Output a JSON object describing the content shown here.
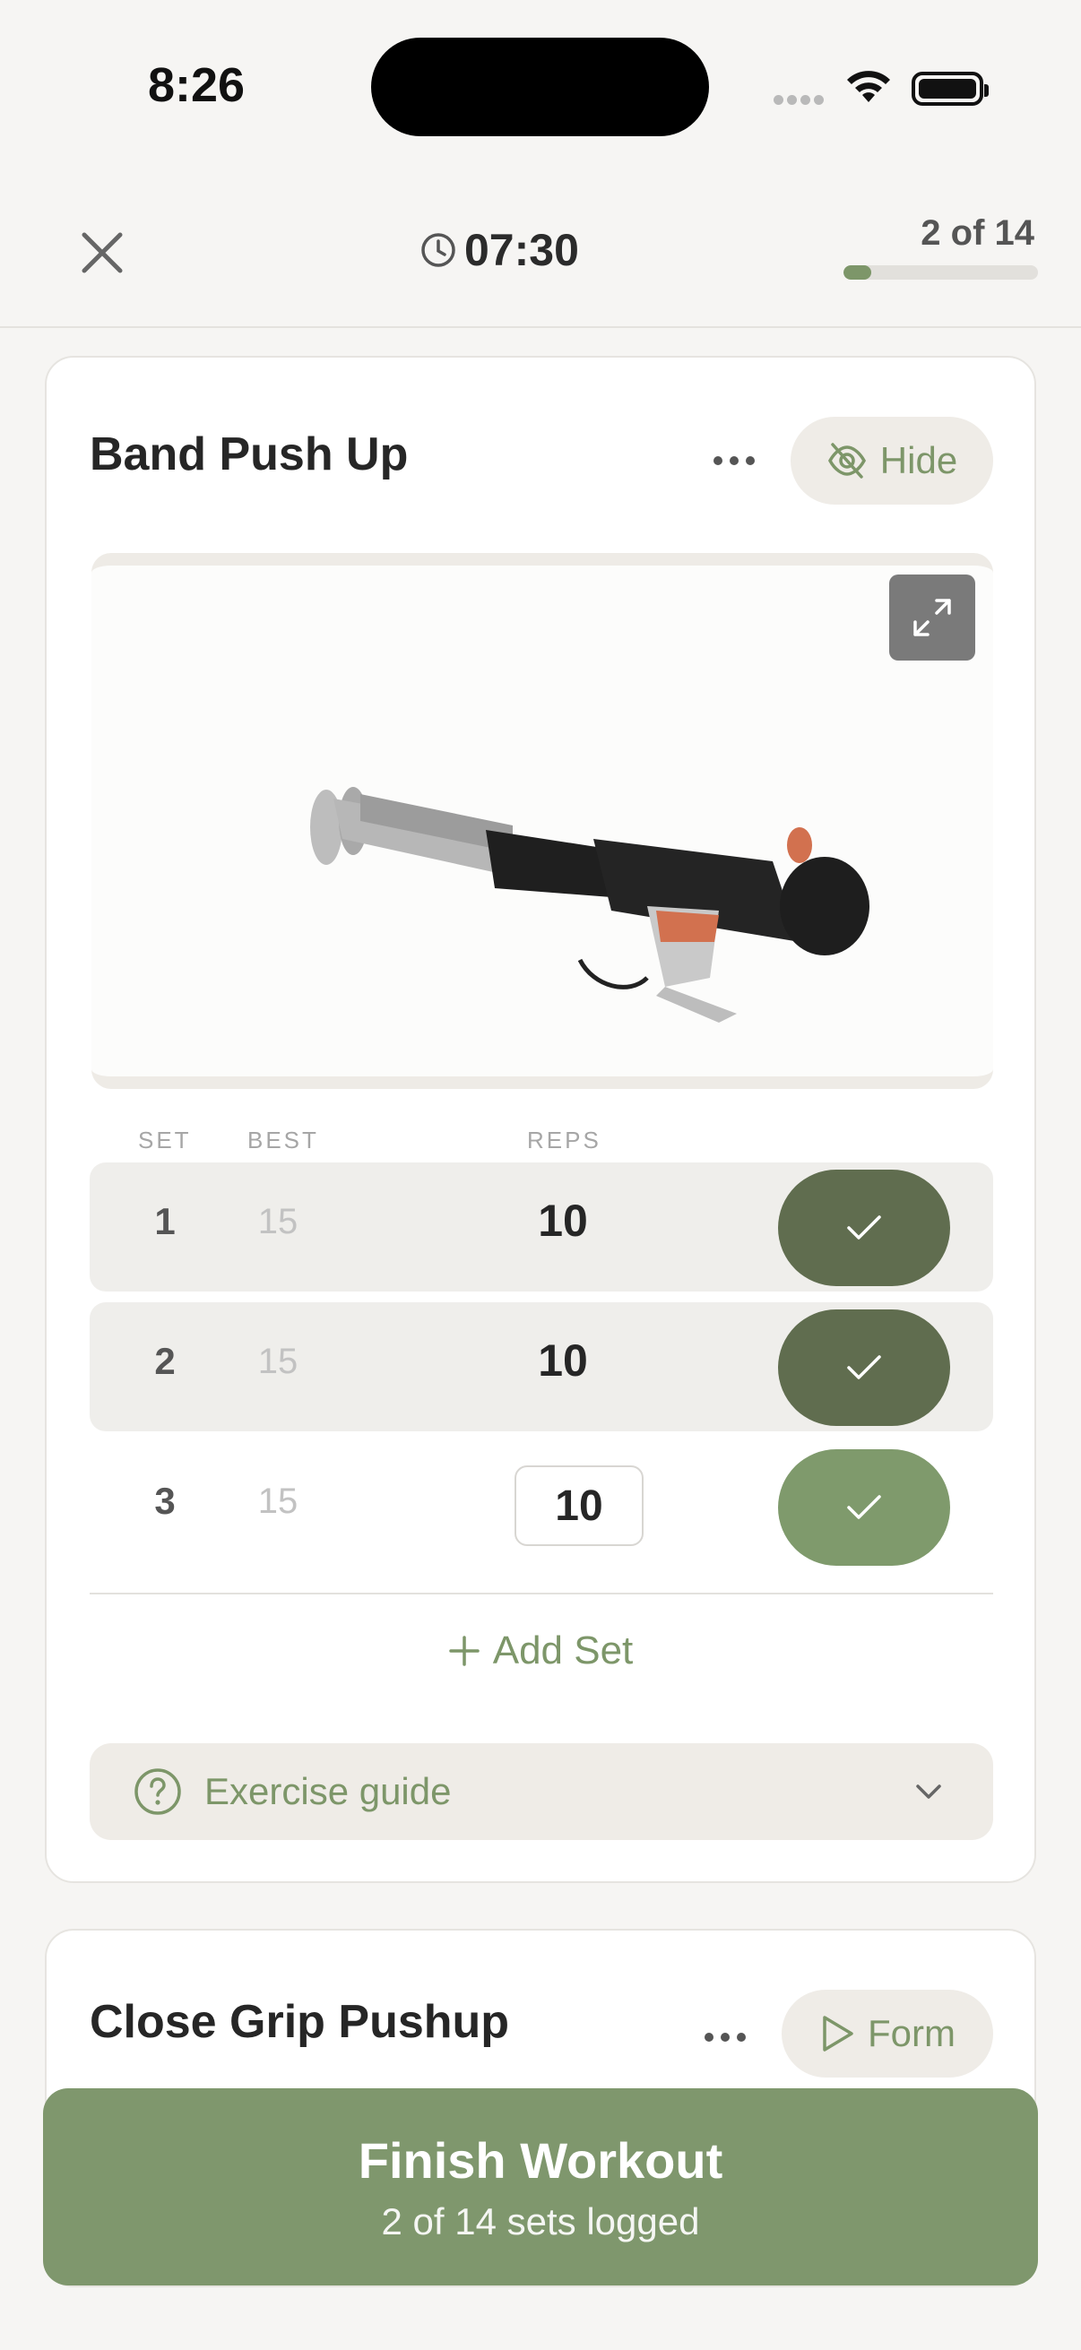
{
  "status_bar": {
    "time": "8:26"
  },
  "header": {
    "timer": "07:30",
    "progress_label": "2 of 14",
    "progress_fraction": 0.143
  },
  "exercise_1": {
    "title": "Band Push Up",
    "hide_label": "Hide",
    "columns": {
      "set": "SET",
      "best": "BEST",
      "reps": "REPS"
    },
    "sets": [
      {
        "set": "1",
        "best": "15",
        "reps": "10",
        "completed": true
      },
      {
        "set": "2",
        "best": "15",
        "reps": "10",
        "completed": true
      },
      {
        "set": "3",
        "best": "15",
        "reps": "10",
        "completed": false
      }
    ],
    "add_set_label": "Add Set",
    "guide_label": "Exercise guide"
  },
  "exercise_2": {
    "title": "Close Grip Pushup",
    "form_label": "Form"
  },
  "finish": {
    "title": "Finish Workout",
    "subtitle": "2 of 14 sets logged"
  },
  "colors": {
    "accent": "#7d9669",
    "check_done": "#606d4f",
    "check_pending": "#7f9a6c",
    "background": "#f6f5f3"
  },
  "icons": [
    "close-icon",
    "clock-icon",
    "ellipsis-icon",
    "eye-off-icon",
    "expand-icon",
    "check-icon",
    "plus-icon",
    "help-circle-icon",
    "chevron-down-icon",
    "play-icon"
  ]
}
